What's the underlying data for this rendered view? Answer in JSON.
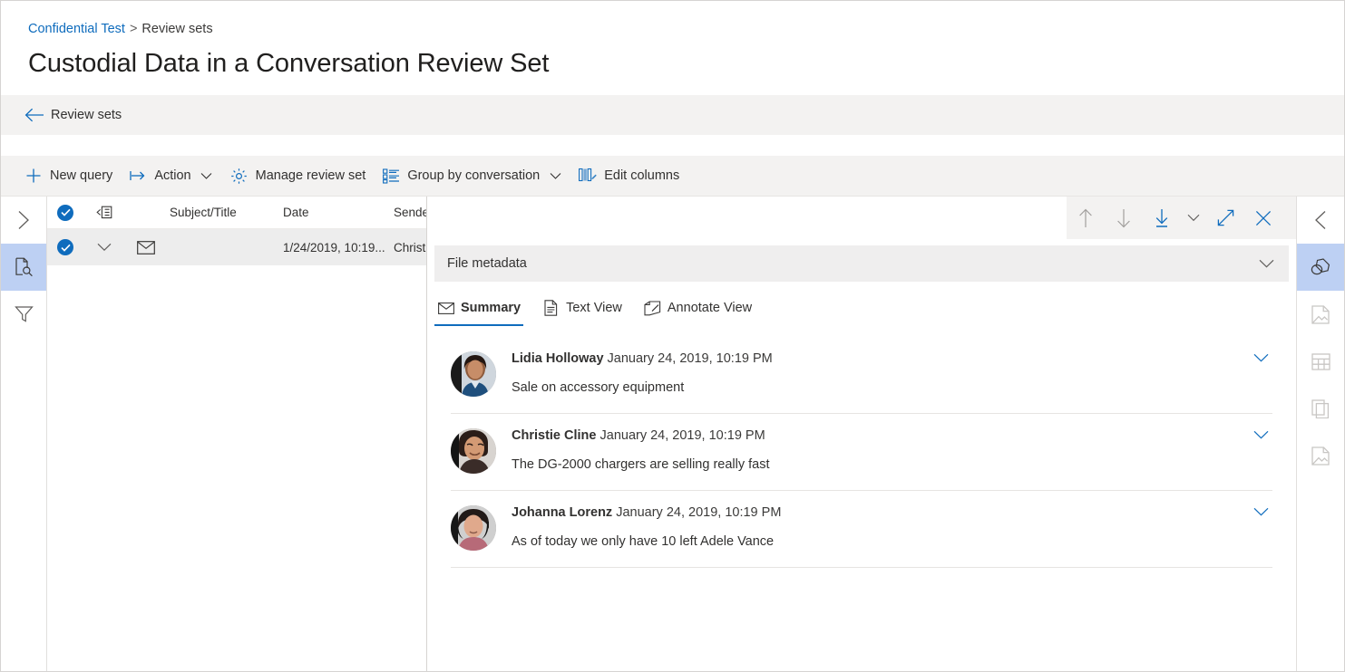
{
  "breadcrumb": {
    "root": "Confidential Test",
    "separator": ">",
    "current": "Review sets"
  },
  "page_title": "Custodial Data in a Conversation Review Set",
  "back_bar": {
    "label": "Review sets",
    "icon": "arrow-left-icon"
  },
  "command_bar": {
    "items": [
      {
        "label": "New query",
        "icon": "plus-icon",
        "has_caret": false
      },
      {
        "label": "Action",
        "icon": "action-arrow-icon",
        "has_caret": true
      },
      {
        "label": "Manage review set",
        "icon": "gear-icon",
        "has_caret": false
      },
      {
        "label": "Group by conversation",
        "icon": "group-list-icon",
        "has_caret": true
      },
      {
        "label": "Edit columns",
        "icon": "edit-columns-icon",
        "has_caret": false
      }
    ]
  },
  "left_rail": {
    "items": [
      {
        "name": "expand-panel",
        "icon": "chevron-right-icon",
        "selected": false
      },
      {
        "name": "search-documents",
        "icon": "document-search-icon",
        "selected": true
      },
      {
        "name": "filters",
        "icon": "filter-funnel-icon",
        "selected": false
      }
    ]
  },
  "right_rail": {
    "items": [
      {
        "name": "collapse-panel",
        "icon": "chevron-left-icon",
        "selected": false,
        "dim": false
      },
      {
        "name": "annotate",
        "icon": "tag-icon",
        "selected": true,
        "dim": false
      },
      {
        "name": "file-info",
        "icon": "document-page-icon",
        "selected": false,
        "dim": true
      },
      {
        "name": "table-view",
        "icon": "table-grid-icon",
        "selected": false,
        "dim": true
      },
      {
        "name": "duplicates",
        "icon": "copy-stack-icon",
        "selected": false,
        "dim": true
      },
      {
        "name": "near-duplicates",
        "icon": "document-page-icon",
        "selected": false,
        "dim": true
      }
    ]
  },
  "list": {
    "columns": [
      "",
      "",
      "",
      "Subject/Title",
      "Date",
      "Sender"
    ],
    "header": {
      "select_all_checked": true,
      "expand_icon": "collapse-rows-icon",
      "subject": "Subject/Title",
      "date": "Date",
      "sender": "Sender"
    },
    "rows": [
      {
        "checked": true,
        "expand_icon": "chevron-down-icon",
        "type_icon": "mail-icon",
        "subject": "",
        "date": "1/24/2019, 10:19...",
        "sender": "Christie"
      }
    ]
  },
  "detail": {
    "toolbar": [
      {
        "name": "previous-item",
        "icon": "arrow-up-icon",
        "disabled": true
      },
      {
        "name": "next-item",
        "icon": "arrow-down-icon",
        "disabled": true
      },
      {
        "name": "download",
        "icon": "download-icon",
        "disabled": false
      },
      {
        "name": "download-options",
        "icon": "chevron-down-icon",
        "disabled": false
      },
      {
        "name": "expand-view",
        "icon": "expand-diagonal-icon",
        "disabled": false
      },
      {
        "name": "close-panel",
        "icon": "close-icon",
        "disabled": false
      }
    ],
    "metadata_bar": {
      "label": "File metadata",
      "caret_icon": "chevron-down-icon",
      "expanded": false
    },
    "tabs": [
      {
        "label": "Summary",
        "icon": "mail-icon",
        "active": true
      },
      {
        "label": "Text View",
        "icon": "document-text-icon",
        "active": false
      },
      {
        "label": "Annotate View",
        "icon": "annotate-pen-icon",
        "active": false
      }
    ],
    "messages": [
      {
        "author": "Lidia Holloway",
        "date": "January 24, 2019, 10:19 PM",
        "text": "Sale on accessory equipment",
        "caret_icon": "chevron-down-icon",
        "avatar_colors": [
          "#2f4157",
          "#c98a6e",
          "#1d4e7a"
        ]
      },
      {
        "author": "Christie Cline",
        "date": "January 24, 2019, 10:19 PM",
        "text": "The DG-2000 chargers are selling really fast",
        "caret_icon": "chevron-down-icon",
        "avatar_colors": [
          "#3a2c28",
          "#d9a282",
          "#7a5b4b"
        ]
      },
      {
        "author": "Johanna Lorenz",
        "date": "January 24, 2019, 10:19 PM",
        "text": "As of today we only have 10 left Adele Vance",
        "caret_icon": "chevron-down-icon",
        "avatar_colors": [
          "#241c1a",
          "#e0a98c",
          "#b76a78"
        ]
      }
    ]
  },
  "colors": {
    "accent": "#0f6cbd",
    "selected_rail": "#bdd0f3",
    "chrome_gray": "#f3f2f1",
    "row_selected": "#ededed"
  }
}
